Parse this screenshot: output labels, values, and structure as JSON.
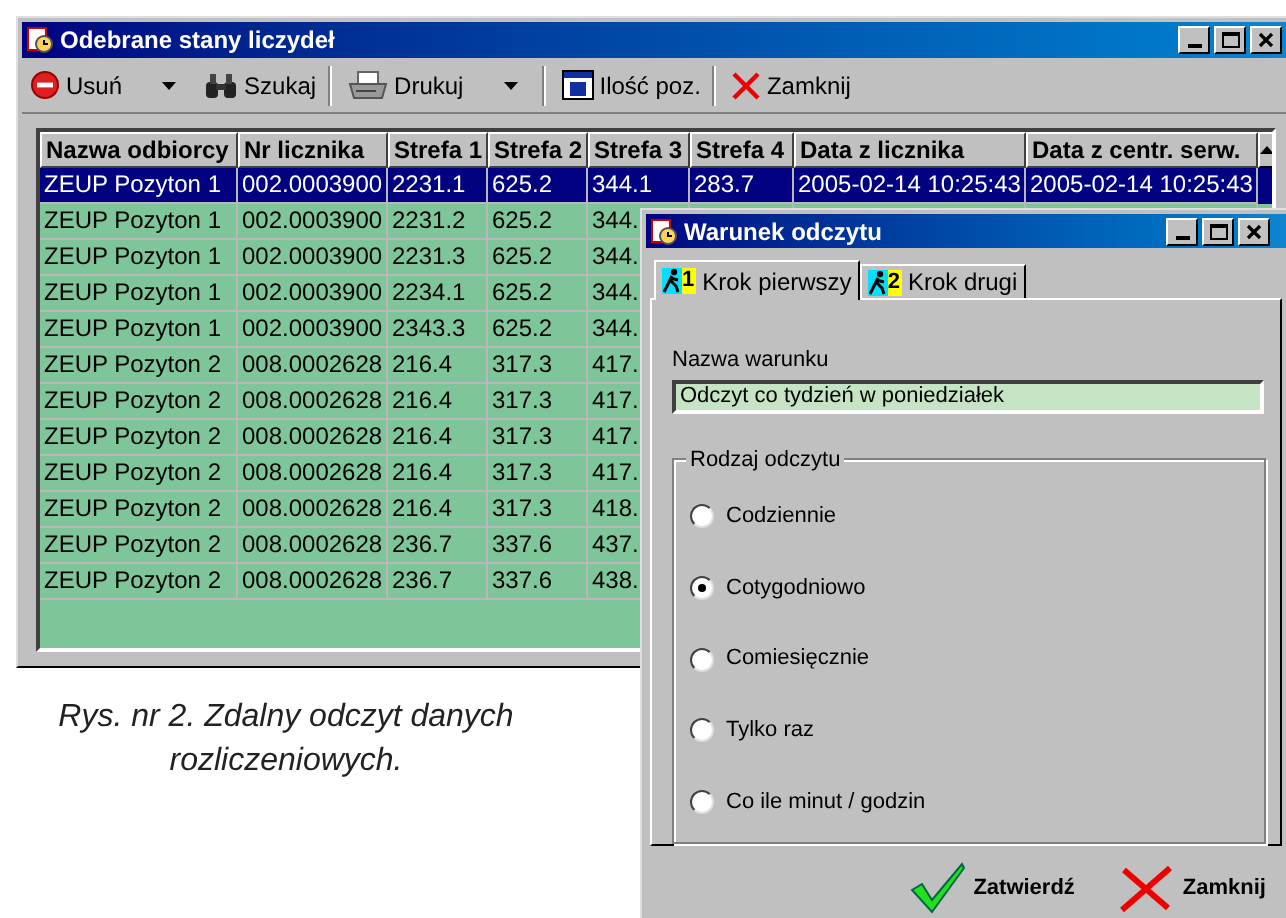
{
  "main_window": {
    "title": "Odebrane stany liczydeł",
    "toolbar": [
      {
        "kind": "delete",
        "label": "Usuń",
        "dropdown": true
      },
      {
        "kind": "search",
        "label": "Szukaj",
        "dropdown": false
      },
      {
        "kind": "print",
        "label": "Drukuj",
        "dropdown": true
      },
      {
        "kind": "count",
        "label": "Ilość poz.",
        "dropdown": false
      },
      {
        "kind": "close",
        "label": "Zamknij",
        "dropdown": false
      }
    ],
    "table": {
      "columns": [
        "Nazwa odbiorcy",
        "Nr licznika",
        "Strefa 1",
        "Strefa 2",
        "Strefa 3",
        "Strefa 4",
        "Data z licznika",
        "Data z centr. serw."
      ],
      "rows": [
        {
          "selected": true,
          "cells": [
            "ZEUP Pozyton 1",
            "002.0003900",
            "2231.1",
            "625.2",
            "344.1",
            "283.7",
            "2005-02-14 10:25:43",
            "2005-02-14 10:25:43"
          ]
        },
        {
          "selected": false,
          "cells": [
            "ZEUP Pozyton 1",
            "002.0003900",
            "2231.2",
            "625.2",
            "344."
          ]
        },
        {
          "selected": false,
          "cells": [
            "ZEUP Pozyton 1",
            "002.0003900",
            "2231.3",
            "625.2",
            "344."
          ]
        },
        {
          "selected": false,
          "cells": [
            "ZEUP Pozyton 1",
            "002.0003900",
            "2234.1",
            "625.2",
            "344."
          ]
        },
        {
          "selected": false,
          "cells": [
            "ZEUP Pozyton 1",
            "002.0003900",
            "2343.3",
            "625.2",
            "344."
          ]
        },
        {
          "selected": false,
          "cells": [
            "ZEUP Pozyton 2",
            "008.0002628",
            "216.4",
            "317.3",
            "417."
          ]
        },
        {
          "selected": false,
          "cells": [
            "ZEUP Pozyton 2",
            "008.0002628",
            "216.4",
            "317.3",
            "417."
          ]
        },
        {
          "selected": false,
          "cells": [
            "ZEUP Pozyton 2",
            "008.0002628",
            "216.4",
            "317.3",
            "417."
          ]
        },
        {
          "selected": false,
          "cells": [
            "ZEUP Pozyton 2",
            "008.0002628",
            "216.4",
            "317.3",
            "417."
          ]
        },
        {
          "selected": false,
          "cells": [
            "ZEUP Pozyton 2",
            "008.0002628",
            "216.4",
            "317.3",
            "418."
          ]
        },
        {
          "selected": false,
          "cells": [
            "ZEUP Pozyton 2",
            "008.0002628",
            "236.7",
            "337.6",
            "437."
          ]
        },
        {
          "selected": false,
          "cells": [
            "ZEUP Pozyton 2",
            "008.0002628",
            "236.7",
            "337.6",
            "438."
          ]
        }
      ]
    }
  },
  "caption": "Rys. nr 2. Zdalny odczyt danych rozliczeniowych.",
  "dialog": {
    "title": "Warunek odczytu",
    "tabs": [
      {
        "step": "1",
        "label": "Krok pierwszy",
        "selected": true
      },
      {
        "step": "2",
        "label": "Krok drugi",
        "selected": false
      }
    ],
    "name_label": "Nazwa warunku",
    "name_value": "Odczyt co tydzień w poniedziałek",
    "group_title": "Rodzaj odczytu",
    "options": [
      {
        "label": "Codziennie",
        "selected": false
      },
      {
        "label": "Cotygodniowo",
        "selected": true
      },
      {
        "label": "Comiesięcznie",
        "selected": false
      },
      {
        "label": "Tylko raz",
        "selected": false
      },
      {
        "label": "Co ile minut / godzin",
        "selected": false
      }
    ],
    "buttons": [
      {
        "kind": "ok",
        "label": "Zatwierdź"
      },
      {
        "kind": "cancel",
        "label": "Zamknij"
      }
    ]
  }
}
